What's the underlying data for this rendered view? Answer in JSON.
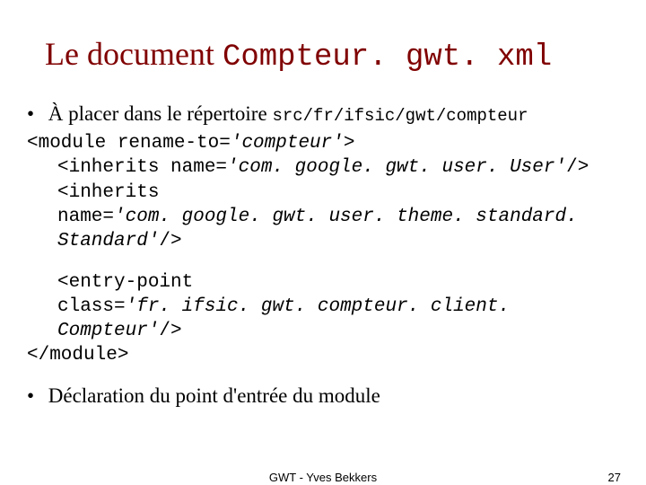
{
  "title": {
    "text_part": "Le document ",
    "code_part": "Compteur. gwt. xml"
  },
  "bullet1": {
    "text": "À placer dans le répertoire ",
    "code": "src/fr/ifsic/gwt/compteur"
  },
  "code_block": {
    "l1a": "<module rename-to=",
    "l1b": "'compteur'",
    "l1c": ">",
    "l2a": "<inherits name=",
    "l2b": "'com. google. gwt. user. User'",
    "l2c": "/>",
    "l3": "<inherits",
    "l4a": "name=",
    "l4b": "'com. google. gwt. user. theme. standard. Standard'",
    "l4c": "/>",
    "l5": "<entry-point",
    "l6a": "class=",
    "l6b": "'fr. ifsic. gwt. compteur. client. Compteur'",
    "l6c": "/>",
    "l7": "</module>"
  },
  "bullet2": {
    "text": "Déclaration du point d'entrée du module"
  },
  "footer": {
    "center": "GWT - Yves Bekkers",
    "page": "27"
  }
}
